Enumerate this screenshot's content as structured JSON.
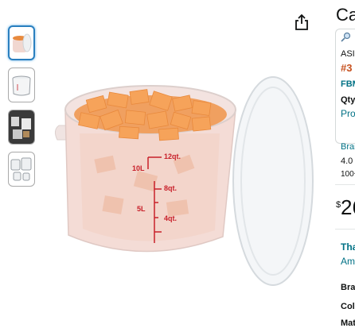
{
  "product": {
    "title": "Ca",
    "thumbnails": [
      {
        "icon": "food-container-with-cantaloupe-thumb",
        "selected": true
      },
      {
        "icon": "round-container-thumb",
        "selected": false
      },
      {
        "icon": "kitchen-lifestyle-thumb",
        "selected": false
      },
      {
        "icon": "container-set-thumb",
        "selected": false
      }
    ],
    "image": {
      "capacity_labels": [
        "12qt.",
        "10L",
        "8qt.",
        "5L",
        "4qt."
      ]
    }
  },
  "side_panel": {
    "search_icon": "magnifier-icon",
    "asin": "ASI",
    "rank": "#3",
    "fbm": "FBM",
    "qty": "Qty",
    "pro": "Pro",
    "brand": "Bran",
    "rating": "4.0",
    "reviews": "100+",
    "price_symbol": "$",
    "price": "26",
    "thanks": "Than",
    "amazon": "Ama",
    "spec_brand": "Bran",
    "spec_color": "Colo",
    "spec_material": "Mate"
  },
  "colors": {
    "accent": "#2a7fbf",
    "link": "#007185",
    "badge": "#c7511f",
    "measure": "#c8202a",
    "star": "#de7921"
  }
}
